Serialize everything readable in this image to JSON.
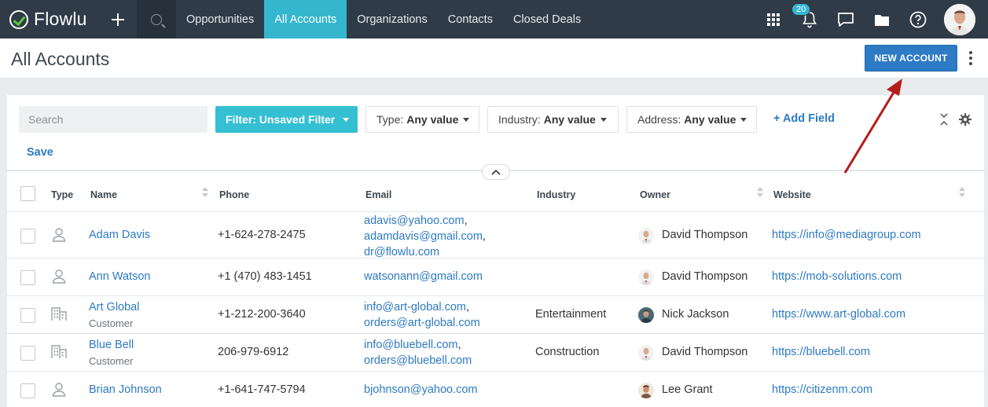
{
  "app": {
    "name": "Flowlu"
  },
  "nav": {
    "items": [
      {
        "label": "Opportunities",
        "active": false
      },
      {
        "label": "All Accounts",
        "active": true
      },
      {
        "label": "Organizations",
        "active": false
      },
      {
        "label": "Contacts",
        "active": false
      },
      {
        "label": "Closed Deals",
        "active": false
      }
    ],
    "notifications_count": "20"
  },
  "header": {
    "title": "All Accounts",
    "new_account_label": "NEW ACCOUNT"
  },
  "filters": {
    "search_placeholder": "Search",
    "filter_button": "Filter: Unsaved Filter",
    "type": {
      "label": "Type:",
      "value": "Any value"
    },
    "industry": {
      "label": "Industry:",
      "value": "Any value"
    },
    "address": {
      "label": "Address:",
      "value": "Any value"
    },
    "add_field": "+ Add Field",
    "save": "Save"
  },
  "table": {
    "columns": [
      "Type",
      "Name",
      "Phone",
      "Email",
      "Industry",
      "Owner",
      "Website"
    ],
    "rows": [
      {
        "type": "person",
        "name": "Adam Davis",
        "subtitle": "",
        "phone": "+1-624-278-2475",
        "emails": [
          "adavis@yahoo.com",
          "adamdavis@gmail.com",
          "dr@flowlu.com"
        ],
        "industry": "",
        "owner": "David Thompson",
        "website": "https://info@mediagroup.com"
      },
      {
        "type": "person",
        "name": "Ann Watson",
        "subtitle": "",
        "phone": "+1 (470) 483-1451",
        "emails": [
          "watsonann@gmail.com"
        ],
        "industry": "",
        "owner": "David Thompson",
        "website": "https://mob-solutions.com"
      },
      {
        "type": "organization",
        "name": "Art Global",
        "subtitle": "Customer",
        "phone": "+1-212-200-3640",
        "emails": [
          "info@art-global.com",
          "orders@art-global.com"
        ],
        "industry": "Entertainment",
        "owner": "Nick Jackson",
        "website": "https://www.art-global.com"
      },
      {
        "type": "organization",
        "name": "Blue Bell",
        "subtitle": "Customer",
        "phone": "206-979-6912",
        "emails": [
          "info@bluebell.com",
          "orders@bluebell.com"
        ],
        "industry": "Construction",
        "owner": "David Thompson",
        "website": "https://bluebell.com"
      },
      {
        "type": "person",
        "name": "Brian Johnson",
        "subtitle": "",
        "phone": "+1-641-747-5794",
        "emails": [
          "bjohnson@yahoo.com"
        ],
        "industry": "",
        "owner": "Lee Grant",
        "website": "https://citizenm.com"
      }
    ]
  },
  "colors": {
    "nav_bg": "#2f3b47",
    "accent": "#35b6cf",
    "primary": "#2d7ac5",
    "annotation_arrow": "#b71c1c"
  }
}
